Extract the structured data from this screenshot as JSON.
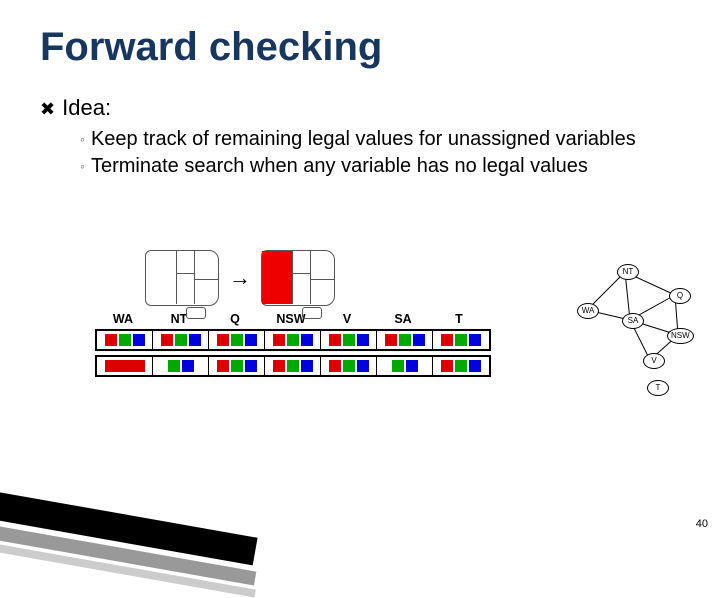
{
  "title": "Forward checking",
  "idea_label": "Idea",
  "idea_colon": ":",
  "subpoints": [
    "Keep track of remaining legal values for unassigned variables",
    "Terminate search when any variable has no legal values"
  ],
  "columns": [
    "WA",
    "NT",
    "Q",
    "NSW",
    "V",
    "SA",
    "T"
  ],
  "domain_rows": [
    {
      "cells": [
        [
          "R",
          "G",
          "B"
        ],
        [
          "R",
          "G",
          "B"
        ],
        [
          "R",
          "G",
          "B"
        ],
        [
          "R",
          "G",
          "B"
        ],
        [
          "R",
          "G",
          "B"
        ],
        [
          "R",
          "G",
          "B"
        ],
        [
          "R",
          "G",
          "B"
        ]
      ]
    },
    {
      "cells": [
        [
          "WIDE_R"
        ],
        [
          "G",
          "B"
        ],
        [
          "R",
          "G",
          "B"
        ],
        [
          "R",
          "G",
          "B"
        ],
        [
          "R",
          "G",
          "B"
        ],
        [
          "G",
          "B"
        ],
        [
          "R",
          "G",
          "B"
        ]
      ]
    }
  ],
  "graph_nodes": [
    "NT",
    "Q",
    "WA",
    "SA",
    "NSW",
    "V",
    "T"
  ],
  "page_number": "40"
}
